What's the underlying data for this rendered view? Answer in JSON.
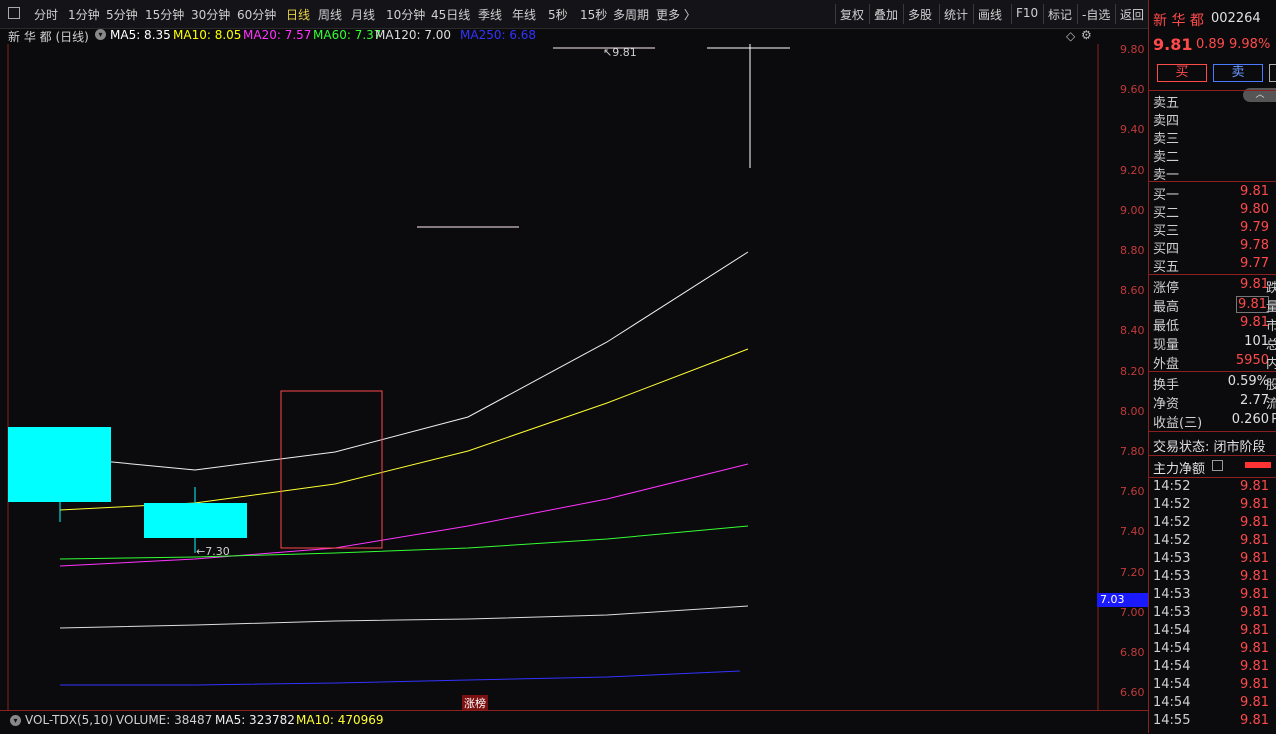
{
  "toolbar": {
    "tabs": [
      "分时",
      "1分钟",
      "5分钟",
      "15分钟",
      "30分钟",
      "60分钟",
      "日线",
      "周线",
      "月线",
      "10分钟",
      "45日线",
      "季线",
      "年线",
      "5秒",
      "15秒",
      "多周期",
      "更多 〉"
    ],
    "active": "日线",
    "right_tabs": [
      "复权",
      "叠加",
      "多股",
      "统计",
      "画线",
      "F10",
      "标记",
      "-自选",
      "返回"
    ]
  },
  "chart": {
    "title": "新 华 都 (日线)",
    "indicators": [
      {
        "label": "MA5: 8.35",
        "color": "#ffffff"
      },
      {
        "label": "MA10: 8.05",
        "color": "#ffff00"
      },
      {
        "label": "MA20: 7.57",
        "color": "#ff33ff"
      },
      {
        "label": "MA60: 7.37",
        "color": "#33ff33"
      },
      {
        "label": "MA120: 7.00",
        "color": "#dddddd"
      },
      {
        "label": "MA250: 6.68",
        "color": "#3333ff"
      }
    ],
    "y_ticks": [
      "9.80",
      "9.60",
      "9.40",
      "9.20",
      "9.00",
      "8.80",
      "8.60",
      "8.40",
      "8.20",
      "8.00",
      "7.80",
      "7.60",
      "7.40",
      "7.20",
      "7.00",
      "6.80",
      "6.60"
    ],
    "high_label": "9.81",
    "low_label": "7.30",
    "price_marker": "7.03",
    "event_tag": "涨榜"
  },
  "volume": {
    "label": "VOL-TDX(5,10)",
    "volume_text": "VOLUME: 38487",
    "ma5_text": "MA5: 323782",
    "ma10_text": "MA10: 470969"
  },
  "quote": {
    "name": "新 华 都",
    "code": "002264",
    "price": "9.81",
    "change": "0.89",
    "pct": "9.98%",
    "buy_btn": "买",
    "sell_btn": "卖",
    "asks": [
      "卖五",
      "卖四",
      "卖三",
      "卖二",
      "卖一"
    ],
    "bids": [
      {
        "label": "买一",
        "price": "9.81"
      },
      {
        "label": "买二",
        "price": "9.80"
      },
      {
        "label": "买三",
        "price": "9.79"
      },
      {
        "label": "买四",
        "price": "9.78"
      },
      {
        "label": "买五",
        "price": "9.77"
      }
    ],
    "stats": [
      {
        "label": "涨停",
        "value": "9.81",
        "ext": "跌"
      },
      {
        "label": "最高",
        "value": "9.81",
        "ext": "量"
      },
      {
        "label": "最低",
        "value": "9.81",
        "ext": "市"
      },
      {
        "label": "现量",
        "value": "101",
        "ext": "总"
      },
      {
        "label": "外盘",
        "value": "5950",
        "ext": "内"
      }
    ],
    "stats2": [
      {
        "label": "换手",
        "value": "0.59%",
        "ext": "股"
      },
      {
        "label": "净资",
        "value": "2.77",
        "ext": "流"
      },
      {
        "label": "收益(三)",
        "value": "0.260",
        "ext": "P"
      }
    ],
    "trade_status": "交易状态: 闭市阶段",
    "mainforce_label": "主力净额",
    "ticks": [
      {
        "t": "14:52",
        "p": "9.81"
      },
      {
        "t": "14:52",
        "p": "9.81"
      },
      {
        "t": "14:52",
        "p": "9.81"
      },
      {
        "t": "14:52",
        "p": "9.81"
      },
      {
        "t": "14:53",
        "p": "9.81"
      },
      {
        "t": "14:53",
        "p": "9.81"
      },
      {
        "t": "14:53",
        "p": "9.81"
      },
      {
        "t": "14:53",
        "p": "9.81"
      },
      {
        "t": "14:54",
        "p": "9.81"
      },
      {
        "t": "14:54",
        "p": "9.81"
      },
      {
        "t": "14:54",
        "p": "9.81"
      },
      {
        "t": "14:54",
        "p": "9.81"
      },
      {
        "t": "14:54",
        "p": "9.81"
      },
      {
        "t": "14:55",
        "p": "9.81"
      }
    ]
  }
}
